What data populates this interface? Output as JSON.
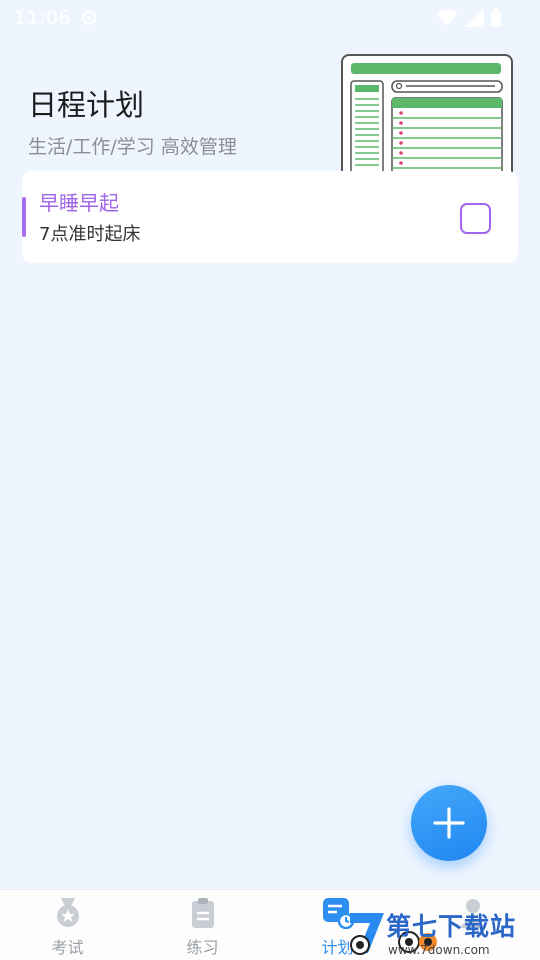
{
  "status_bar": {
    "time": "11:06"
  },
  "header": {
    "title": "日程计划",
    "subtitle": "生活/工作/学习 高效管理"
  },
  "plans": [
    {
      "title": "早睡早起",
      "description": "7点准时起床",
      "done": false
    }
  ],
  "nav": {
    "items": [
      {
        "label": "考试",
        "icon": "medal-icon",
        "active": false
      },
      {
        "label": "练习",
        "icon": "clipboard-icon",
        "active": false
      },
      {
        "label": "计划",
        "icon": "plan-icon",
        "active": true
      },
      {
        "label": "",
        "icon": "person-icon",
        "active": false
      }
    ]
  },
  "watermark": {
    "brand": "第七下载站",
    "url": "www.7down.com"
  },
  "colors": {
    "accent": "#a064ea",
    "primary": "#2d8ef2",
    "background": "#eef5ff"
  }
}
